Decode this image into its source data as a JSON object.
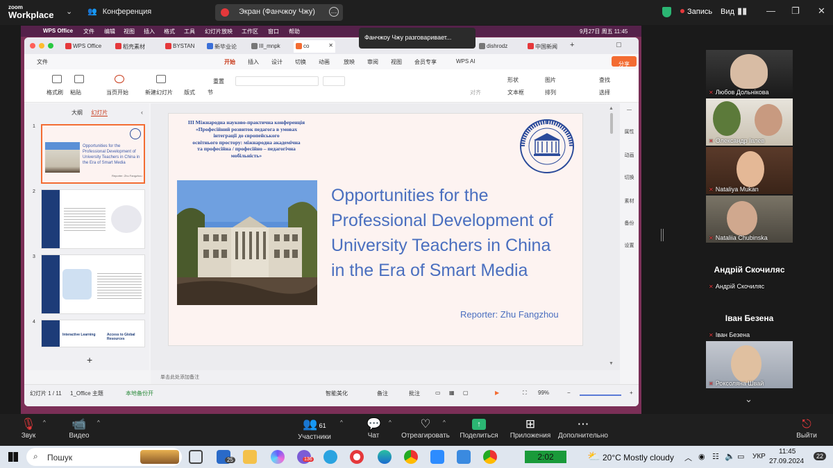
{
  "zoom": {
    "logo_small": "zoom",
    "logo_big": "Workplace",
    "meeting_label": "Конференция",
    "screen_share_label": "Экран (Фанчжоу Чжу)",
    "recording_label": "Запись",
    "view_label": "Вид",
    "speaking_banner": "Фанчжоу Чжу разговаривает...",
    "controls": [
      {
        "label": "Звук"
      },
      {
        "label": "Видео"
      },
      {
        "label": "Участники",
        "count": "61"
      },
      {
        "label": "Чат"
      },
      {
        "label": "Отреагировать"
      },
      {
        "label": "Поделиться"
      },
      {
        "label": "Приложения"
      },
      {
        "label": "Дополнительно"
      },
      {
        "label": "Выйти"
      }
    ],
    "participants": [
      {
        "name": "Любов Дольнікова"
      },
      {
        "name": "Олександр Івлев"
      },
      {
        "name": "Nataliya Mukan"
      },
      {
        "name": "Nataliia Chubinska"
      },
      {
        "big": "Андрій Скочиляс",
        "name": "Андрій Скочиляс"
      },
      {
        "big": "Іван Безена",
        "name": "Іван Безена"
      },
      {
        "name": "Роксоляна Швай"
      }
    ]
  },
  "mac_menu": {
    "items": [
      "WPS Office",
      "文件",
      "编辑",
      "视图",
      "插入",
      "格式",
      "工具",
      "幻灯片放映",
      "工作区",
      "窗口",
      "帮助"
    ],
    "clock": "9月27日 周五 11:45"
  },
  "wps": {
    "tabs": [
      "WPS Office",
      "稻壳素材",
      "BYSTAN",
      "新毕业论",
      "III_mnpk",
      "co",
      "dishrodz",
      "中国新闻"
    ],
    "ribbon_tabs": [
      "文件",
      "开始",
      "插入",
      "设计",
      "切换",
      "动画",
      "放映",
      "审阅",
      "视图",
      "会员专享",
      "WPS AI"
    ],
    "share_btn": "分享",
    "toolbar": {
      "format_painter": "格式刷",
      "paste": "粘贴",
      "from_current": "当页开始",
      "new_slide": "新建幻灯片",
      "layout": "版式",
      "section": "节",
      "reset": "重置",
      "shape": "形状",
      "picture": "图片",
      "textbox": "文本框",
      "arrange": "排列",
      "find": "查找",
      "select": "选择",
      "align": "对齐"
    },
    "panel_tabs": [
      "大纲",
      "幻灯片"
    ],
    "right_rail": [
      "属性",
      "动画",
      "切换",
      "素材",
      "备份",
      "设置"
    ],
    "notes_placeholder": "单击此处添加备注",
    "status": {
      "slide_count": "幻灯片 1 / 11",
      "theme": "1_Office 主题",
      "backup": "本地备份开",
      "beautify": "智能美化",
      "notes": "备注",
      "comment": "批注",
      "zoom": "99%"
    },
    "thumbs": [
      {
        "num": "1",
        "title": "Opportunities for the Professional Development of University Teachers in China in the Era of Smart Media",
        "reporter": "Reporter: Zhu Fangzhou"
      },
      {
        "num": "2"
      },
      {
        "num": "3"
      },
      {
        "num": "4",
        "left": "Interactive Learning",
        "right": "Access to Global Resources"
      }
    ],
    "add_slide": "+"
  },
  "slide": {
    "header_lines": [
      "ІІІ Міжнародна науково-практична конференція",
      "«Професійний розвиток педагога в умовах",
      "інтеграції до європейського",
      "освітнього простору: міжнародна академічна",
      "та професійна / професійно – педагогічна",
      "мобільність»"
    ],
    "title_lines": [
      "Opportunities for the",
      "Professional Development of",
      "University Teachers in China",
      "in the Era of Smart Media"
    ],
    "reporter": "Reporter: Zhu Fangzhou",
    "seal_text": "НАЦІОНАЛЬНИЙ УНІВЕРСИТЕТ ЛЬВІВСЬКА ПОЛІТЕХНІКА"
  },
  "taskbar": {
    "search": "Пошук",
    "timer": "2:02",
    "weather": "20°C  Mostly cloudy",
    "lang": "УКР",
    "time": "11:45",
    "date": "27.09.2024",
    "notif": "22",
    "badge_mail": "25",
    "badge_viber": "136"
  },
  "colors": {
    "title_blue": "#4a6fbf",
    "header_blue": "#2a4a9a",
    "zoom_bg": "#1f1f1f",
    "record_red": "#e5383b",
    "share_green": "#2bb673",
    "wps_orange": "#f36c32"
  }
}
